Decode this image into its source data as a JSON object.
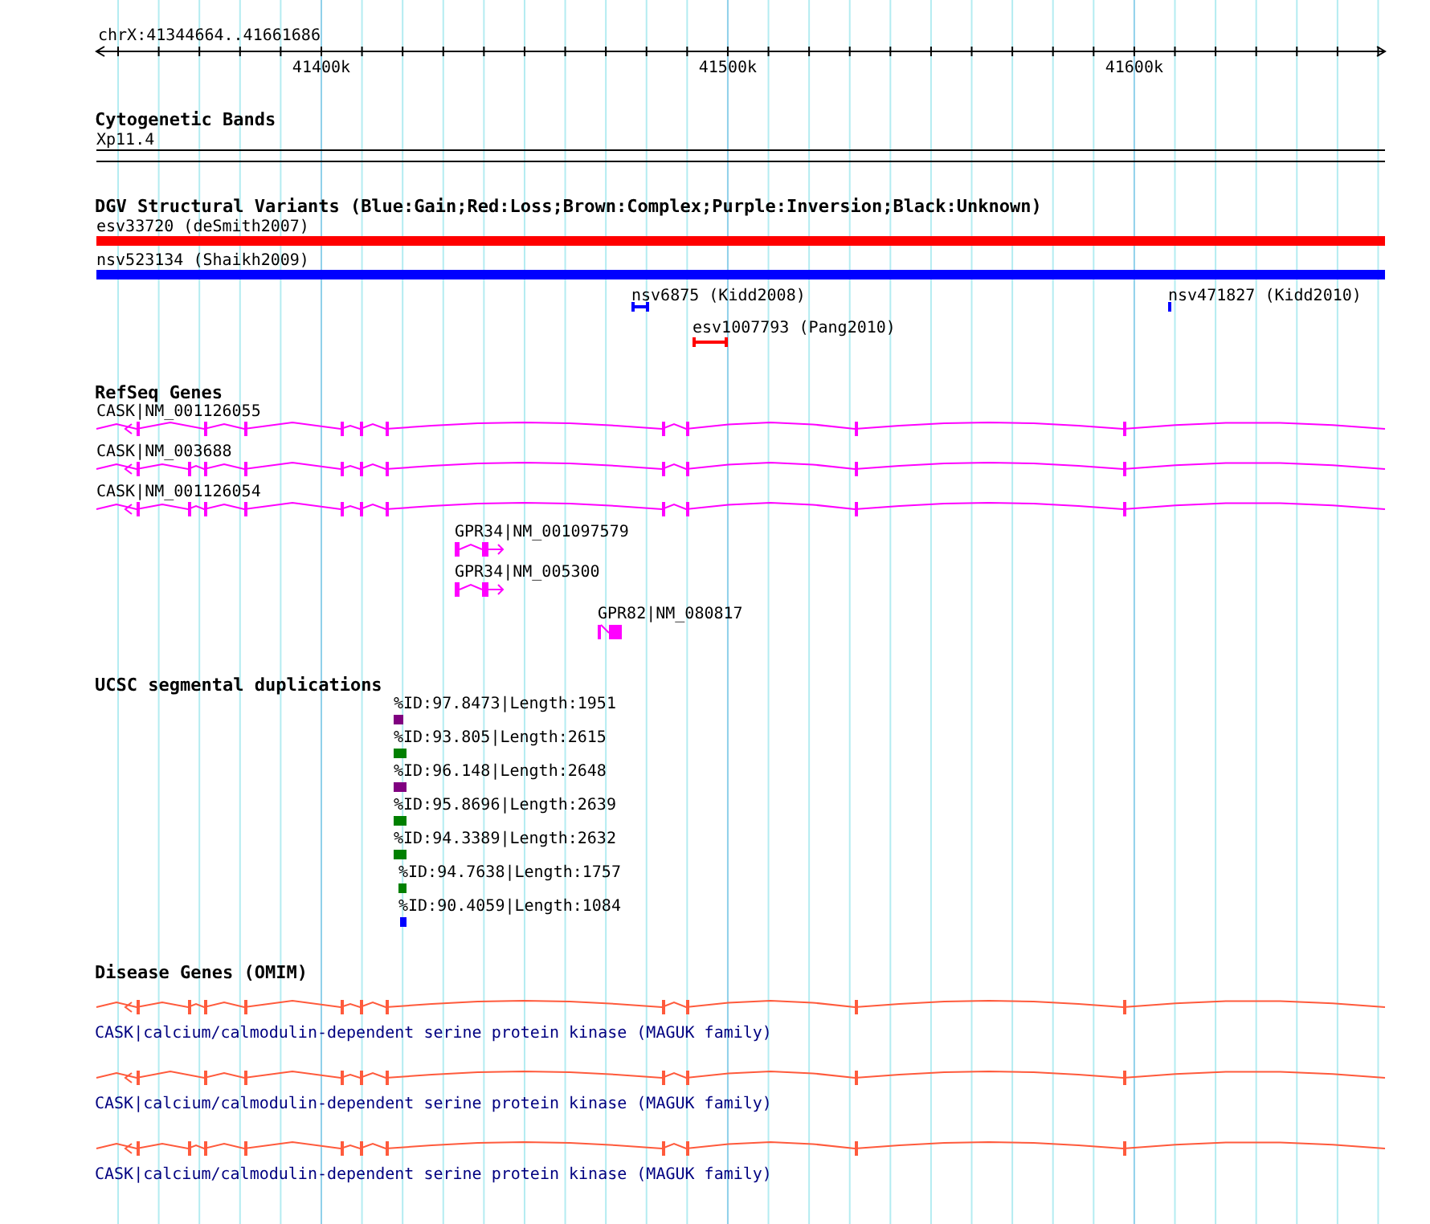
{
  "ruler": {
    "position": "chrX:41344664..41661686",
    "ticks": [
      "41400k",
      "41500k",
      "41600k"
    ]
  },
  "tracks": [
    {
      "kind": "bands",
      "title": "Cytogenetic Bands",
      "features": [
        {
          "label": "Xp11.4"
        }
      ]
    },
    {
      "kind": "variants",
      "title": "DGV Structural Variants (Blue:Gain;Red:Loss;Brown:Complex;Purple:Inversion;Black:Unknown)",
      "features": [
        {
          "label": "esv33720 (deSmith2007)",
          "color": "#ff0000"
        },
        {
          "label": "nsv523134 (Shaikh2009)",
          "color": "#0000ff"
        },
        {
          "label": "nsv6875 (Kidd2008)",
          "color": "#0000ff"
        },
        {
          "label": "nsv471827 (Kidd2010)",
          "color": "#0000ff"
        },
        {
          "label": "esv1007793 (Pang2010)",
          "color": "#ff0000"
        }
      ]
    },
    {
      "kind": "genes",
      "title": "RefSeq Genes",
      "features": [
        {
          "label": "CASK|NM_001126055"
        },
        {
          "label": "CASK|NM_003688"
        },
        {
          "label": "CASK|NM_001126054"
        },
        {
          "label": "GPR34|NM_001097579"
        },
        {
          "label": "GPR34|NM_005300"
        },
        {
          "label": "GPR82|NM_080817"
        }
      ]
    },
    {
      "kind": "dups",
      "title": "UCSC segmental duplications",
      "features": [
        {
          "label": "%ID:97.8473|Length:1951",
          "color": "#800080"
        },
        {
          "label": "%ID:93.805|Length:2615",
          "color": "#008000"
        },
        {
          "label": "%ID:96.148|Length:2648",
          "color": "#800080"
        },
        {
          "label": "%ID:95.8696|Length:2639",
          "color": "#008000"
        },
        {
          "label": "%ID:94.3389|Length:2632",
          "color": "#008000"
        },
        {
          "label": "%ID:94.7638|Length:1757",
          "color": "#008000"
        },
        {
          "label": "%ID:90.4059|Length:1084",
          "color": "#0000ff"
        }
      ]
    },
    {
      "kind": "disease",
      "title": "Disease Genes (OMIM)",
      "features": [
        {
          "label": "CASK|calcium/calmodulin-dependent serine protein kinase (MAGUK family)"
        },
        {
          "label": "CASK|calcium/calmodulin-dependent serine protein kinase (MAGUK family)"
        },
        {
          "label": "CASK|calcium/calmodulin-dependent serine protein kinase (MAGUK family)"
        }
      ]
    }
  ]
}
